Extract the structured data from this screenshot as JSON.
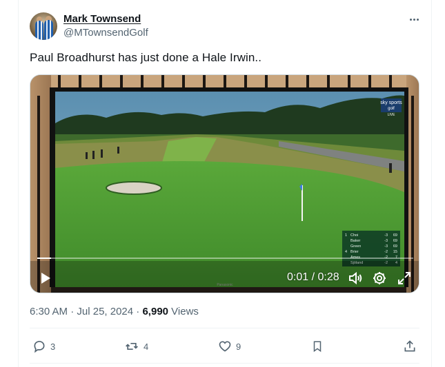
{
  "author": {
    "name": "Mark Townsend",
    "handle": "@MTownsendGolf"
  },
  "tweet": {
    "text": "Paul Broadhurst has just done a Hale Irwin.."
  },
  "video": {
    "time": "0:01 / 0:28",
    "broadcaster_line1": "sky sports",
    "broadcaster_line2": "golf",
    "live_label": "LIVE",
    "leaderboard": [
      {
        "pos": "1",
        "name": "Choi",
        "score": "-3",
        "thru": "69"
      },
      {
        "pos": "",
        "name": "Baker",
        "score": "-3",
        "thru": "69"
      },
      {
        "pos": "",
        "name": "Green",
        "score": "-3",
        "thru": "69"
      },
      {
        "pos": "4",
        "name": "Brier",
        "score": "-2",
        "thru": "15"
      },
      {
        "pos": "",
        "name": "Ames",
        "score": "-2",
        "thru": "7"
      },
      {
        "pos": "",
        "name": "Sjöland",
        "score": "-2",
        "thru": "4"
      }
    ],
    "tv_brand": "Panasonic"
  },
  "meta": {
    "time": "6:30 AM",
    "separator": " · ",
    "date": "Jul 25, 2024",
    "views_count": "6,990",
    "views_label": " Views"
  },
  "actions": {
    "replies": "3",
    "reposts": "4",
    "likes": "9"
  },
  "colors": {
    "text_primary": "#0f1419",
    "text_secondary": "#536471",
    "border": "#eff3f4"
  }
}
